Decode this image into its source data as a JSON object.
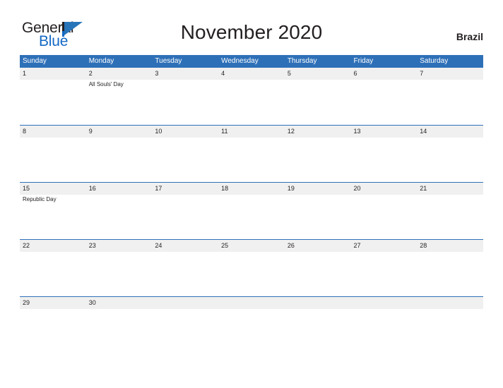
{
  "brand": {
    "name_part1": "General",
    "name_part2": "Blue",
    "flag_icon": "flag-icon",
    "accent_blue": "#1368c4",
    "flag_blue": "#2874b8"
  },
  "header": {
    "title": "November 2020",
    "country": "Brazil"
  },
  "calendar": {
    "header_color": "#2e70b8",
    "band_color": "#f0f0f0",
    "day_names": [
      "Sunday",
      "Monday",
      "Tuesday",
      "Wednesday",
      "Thursday",
      "Friday",
      "Saturday"
    ],
    "weeks": [
      [
        {
          "day": "1",
          "event": ""
        },
        {
          "day": "2",
          "event": "All Souls' Day"
        },
        {
          "day": "3",
          "event": ""
        },
        {
          "day": "4",
          "event": ""
        },
        {
          "day": "5",
          "event": ""
        },
        {
          "day": "6",
          "event": ""
        },
        {
          "day": "7",
          "event": ""
        }
      ],
      [
        {
          "day": "8",
          "event": ""
        },
        {
          "day": "9",
          "event": ""
        },
        {
          "day": "10",
          "event": ""
        },
        {
          "day": "11",
          "event": ""
        },
        {
          "day": "12",
          "event": ""
        },
        {
          "day": "13",
          "event": ""
        },
        {
          "day": "14",
          "event": ""
        }
      ],
      [
        {
          "day": "15",
          "event": "Republic Day"
        },
        {
          "day": "16",
          "event": ""
        },
        {
          "day": "17",
          "event": ""
        },
        {
          "day": "18",
          "event": ""
        },
        {
          "day": "19",
          "event": ""
        },
        {
          "day": "20",
          "event": ""
        },
        {
          "day": "21",
          "event": ""
        }
      ],
      [
        {
          "day": "22",
          "event": ""
        },
        {
          "day": "23",
          "event": ""
        },
        {
          "day": "24",
          "event": ""
        },
        {
          "day": "25",
          "event": ""
        },
        {
          "day": "26",
          "event": ""
        },
        {
          "day": "27",
          "event": ""
        },
        {
          "day": "28",
          "event": ""
        }
      ],
      [
        {
          "day": "29",
          "event": ""
        },
        {
          "day": "30",
          "event": ""
        },
        {
          "day": "",
          "event": ""
        },
        {
          "day": "",
          "event": ""
        },
        {
          "day": "",
          "event": ""
        },
        {
          "day": "",
          "event": ""
        },
        {
          "day": "",
          "event": ""
        }
      ]
    ]
  }
}
